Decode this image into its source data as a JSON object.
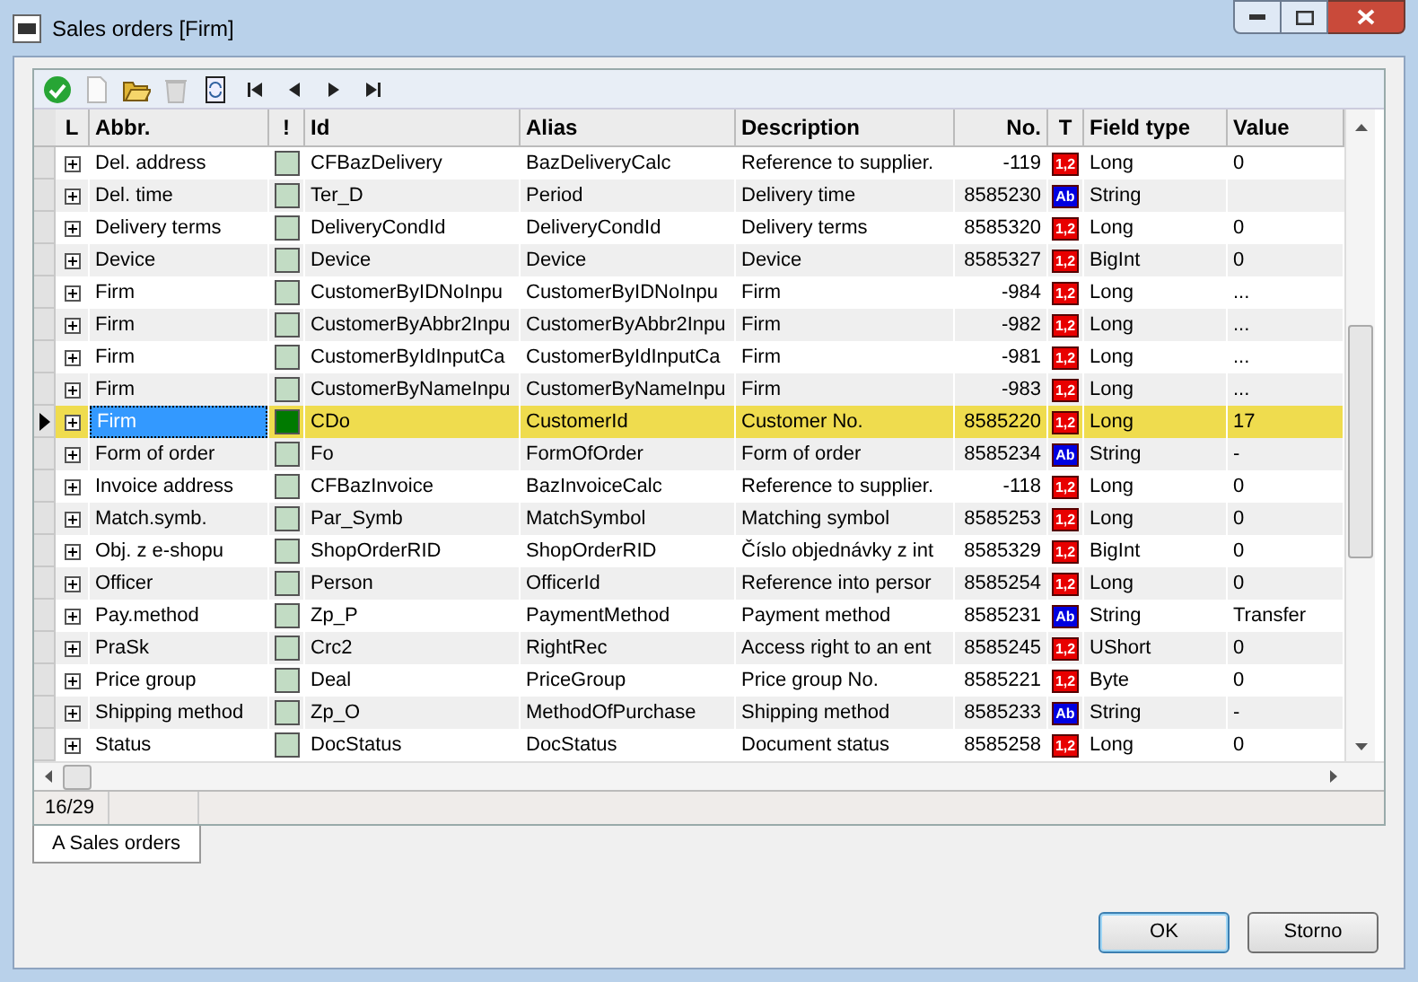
{
  "window": {
    "title": "Sales orders [Firm]"
  },
  "toolbar": [
    {
      "kind": "confirm",
      "disabled": false
    },
    {
      "kind": "new",
      "disabled": true
    },
    {
      "kind": "open",
      "disabled": false
    },
    {
      "kind": "bin",
      "disabled": true
    },
    {
      "kind": "refresh",
      "disabled": false
    },
    {
      "kind": "first",
      "disabled": false
    },
    {
      "kind": "prev",
      "disabled": false
    },
    {
      "kind": "next",
      "disabled": false
    },
    {
      "kind": "last",
      "disabled": false
    }
  ],
  "table": {
    "columns": [
      "L",
      "Abbr.",
      "!",
      "Id",
      "Alias",
      "Description",
      "No.",
      "T",
      "Field type",
      "Value"
    ],
    "rows": [
      {
        "abbr": "Del. address",
        "id": "CFBazDelivery",
        "alias": "BazDeliveryCalc",
        "description": "Reference to supplier.",
        "no": "-119",
        "type": {
          "kind": "number",
          "label": "1,2"
        },
        "field_type": "Long",
        "value": "0",
        "selected": false
      },
      {
        "abbr": "Del. time",
        "id": "Ter_D",
        "alias": "Period",
        "description": "Delivery time",
        "no": "8585230",
        "type": {
          "kind": "string",
          "label": "Ab"
        },
        "field_type": "String",
        "selected": false
      },
      {
        "abbr": "Delivery terms",
        "id": "DeliveryCondId",
        "alias": "DeliveryCondId",
        "description": "Delivery terms",
        "no": "8585320",
        "type": {
          "kind": "number",
          "label": "1,2"
        },
        "field_type": "Long",
        "value": "0",
        "selected": false
      },
      {
        "abbr": "Device",
        "id": "Device",
        "alias": "Device",
        "description": "Device",
        "no": "8585327",
        "type": {
          "kind": "number",
          "label": "1,2"
        },
        "field_type": "BigInt",
        "value": "0",
        "selected": false
      },
      {
        "abbr": "Firm",
        "id": "CustomerByIDNoInpu",
        "alias": "CustomerByIDNoInpu",
        "description": "Firm",
        "no": "-984",
        "type": {
          "kind": "number",
          "label": "1,2"
        },
        "field_type": "Long",
        "value": "...",
        "selected": false
      },
      {
        "abbr": "Firm",
        "id": "CustomerByAbbr2Inpu",
        "alias": "CustomerByAbbr2Inpu",
        "description": "Firm",
        "no": "-982",
        "type": {
          "kind": "number",
          "label": "1,2"
        },
        "field_type": "Long",
        "value": "...",
        "selected": false
      },
      {
        "abbr": "Firm",
        "id": "CustomerByIdInputCa",
        "alias": "CustomerByIdInputCa",
        "description": "Firm",
        "no": "-981",
        "type": {
          "kind": "number",
          "label": "1,2"
        },
        "field_type": "Long",
        "value": "...",
        "selected": false
      },
      {
        "abbr": "Firm",
        "id": "CustomerByNameInpu",
        "alias": "CustomerByNameInpu",
        "description": "Firm",
        "no": "-983",
        "type": {
          "kind": "number",
          "label": "1,2"
        },
        "field_type": "Long",
        "value": "...",
        "selected": false
      },
      {
        "abbr": "Firm",
        "id": "CDo",
        "alias": "CustomerId",
        "description": "Customer No.",
        "no": "8585220",
        "type": {
          "kind": "number",
          "label": "1,2"
        },
        "field_type": "Long",
        "value": "17",
        "selected": true
      },
      {
        "abbr": "Form of order",
        "id": "Fo",
        "alias": "FormOfOrder",
        "description": "Form of order",
        "no": "8585234",
        "type": {
          "kind": "string",
          "label": "Ab"
        },
        "field_type": "String",
        "value": "-",
        "selected": false
      },
      {
        "abbr": "Invoice address",
        "id": "CFBazInvoice",
        "alias": "BazInvoiceCalc",
        "description": "Reference to supplier.",
        "no": "-118",
        "type": {
          "kind": "number",
          "label": "1,2"
        },
        "field_type": "Long",
        "value": "0",
        "selected": false
      },
      {
        "abbr": "Match.symb.",
        "id": "Par_Symb",
        "alias": "MatchSymbol",
        "description": "Matching symbol",
        "no": "8585253",
        "type": {
          "kind": "number",
          "label": "1,2"
        },
        "field_type": "Long",
        "value": "0",
        "selected": false
      },
      {
        "abbr": "Obj. z e-shopu",
        "id": "ShopOrderRID",
        "alias": "ShopOrderRID",
        "description": "Číslo objednávky z int",
        "no": "8585329",
        "type": {
          "kind": "number",
          "label": "1,2"
        },
        "field_type": "BigInt",
        "value": "0",
        "selected": false
      },
      {
        "abbr": "Officer",
        "id": "Person",
        "alias": "OfficerId",
        "description": "Reference into persor",
        "no": "8585254",
        "type": {
          "kind": "number",
          "label": "1,2"
        },
        "field_type": "Long",
        "value": "0",
        "selected": false
      },
      {
        "abbr": "Pay.method",
        "id": "Zp_P",
        "alias": "PaymentMethod",
        "description": "Payment method",
        "no": "8585231",
        "type": {
          "kind": "string",
          "label": "Ab"
        },
        "field_type": "String",
        "value": "Transfer",
        "selected": false
      },
      {
        "abbr": "PraSk",
        "id": "Crc2",
        "alias": "RightRec",
        "description": "Access right to an ent",
        "no": "8585245",
        "type": {
          "kind": "number",
          "label": "1,2"
        },
        "field_type": "UShort",
        "value": "0",
        "selected": false
      },
      {
        "abbr": "Price group",
        "id": "Deal",
        "alias": "PriceGroup",
        "description": "Price group No.",
        "no": "8585221",
        "type": {
          "kind": "number",
          "label": "1,2"
        },
        "field_type": "Byte",
        "value": "0",
        "selected": false
      },
      {
        "abbr": "Shipping method",
        "id": "Zp_O",
        "alias": "MethodOfPurchase",
        "description": "Shipping method",
        "no": "8585233",
        "type": {
          "kind": "string",
          "label": "Ab"
        },
        "field_type": "String",
        "value": "-",
        "selected": false
      },
      {
        "abbr": "Status",
        "id": "DocStatus",
        "alias": "DocStatus",
        "description": "Document status",
        "no": "8585258",
        "type": {
          "kind": "number",
          "label": "1,2"
        },
        "field_type": "Long",
        "value": "0",
        "selected": false
      }
    ]
  },
  "status_bar": {
    "position": "16/29"
  },
  "tabs": [
    {
      "label": "A Sales orders",
      "selected": true
    }
  ],
  "buttons": [
    {
      "label": "OK",
      "default": true
    },
    {
      "label": "Storno",
      "default": false
    }
  ]
}
